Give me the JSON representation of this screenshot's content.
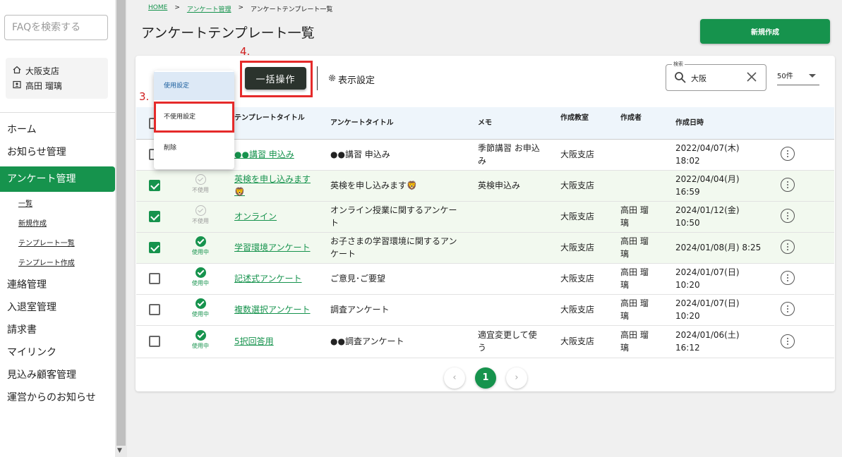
{
  "sidebar": {
    "faq_placeholder": "FAQを検索する",
    "branch": "大阪支店",
    "user": "高田 瑠璃",
    "menu": [
      "ホーム",
      "お知らせ管理",
      "アンケート管理"
    ],
    "submenu": [
      "一覧",
      "新規作成",
      "テンプレート一覧",
      "テンプレート作成"
    ],
    "menu2": [
      "連絡管理",
      "入退室管理",
      "請求書",
      "マイリンク",
      "見込み顧客管理",
      "運営からのお知らせ"
    ]
  },
  "breadcrumb": {
    "home": "HOME",
    "survey": "アンケート管理",
    "current": "アンケートテンプレート一覧",
    "sep": ">"
  },
  "page_title": "アンケートテンプレート一覧",
  "new_button": "新規作成",
  "toolbar": {
    "bulk_label": "一括操作",
    "display_settings": "表示設定",
    "search_label": "検索",
    "search_value": "大阪",
    "per_page": "50件"
  },
  "annotations": {
    "step3": "3.",
    "step4": "4."
  },
  "dropdown": [
    "使用設定",
    "不使用設定",
    "削除"
  ],
  "table": {
    "headers": {
      "template_title": "テンプレートタイトル",
      "survey_title": "アンケートタイトル",
      "memo": "メモ",
      "classroom": "作成教室",
      "creator": "作成者",
      "created_at": "作成日時"
    },
    "rows": [
      {
        "status": "",
        "title": "●●講習 申込み",
        "survey": "●●講習 申込み",
        "memo": "季節講習 お申込み",
        "classroom": "大阪支店",
        "creator": "",
        "date": "2022/04/07(木) 18:02"
      },
      {
        "status": "不使用",
        "title": "英検を申し込みます🦁",
        "survey": "英検を申し込みます🦁",
        "memo": "英検申込み",
        "classroom": "大阪支店",
        "creator": "",
        "date": "2022/04/04(月) 16:59"
      },
      {
        "status": "不使用",
        "title": "オンライン",
        "survey": "オンライン授業に関するアンケート",
        "memo": "",
        "classroom": "大阪支店",
        "creator": "高田 瑠璃",
        "date": "2024/01/12(金) 10:50"
      },
      {
        "status": "使用中",
        "title": "学習環境アンケート",
        "survey": "お子さまの学習環境に関するアンケート",
        "memo": "",
        "classroom": "大阪支店",
        "creator": "高田 瑠璃",
        "date": "2024/01/08(月) 8:25"
      },
      {
        "status": "使用中",
        "title": "記述式アンケート",
        "survey": "ご意見･ご要望",
        "memo": "",
        "classroom": "大阪支店",
        "creator": "高田 瑠璃",
        "date": "2024/01/07(日) 10:20"
      },
      {
        "status": "使用中",
        "title": "複数選択アンケート",
        "survey": "調査アンケート",
        "memo": "",
        "classroom": "大阪支店",
        "creator": "高田 瑠璃",
        "date": "2024/01/07(日) 10:20"
      },
      {
        "status": "使用中",
        "title": "5択回答用",
        "survey": "●●調査アンケート",
        "memo": "適宜変更して使う",
        "classroom": "大阪支店",
        "creator": "高田 瑠璃",
        "date": "2024/01/06(土) 16:12"
      }
    ]
  },
  "pagination": {
    "current": "1",
    "prev": "‹",
    "next": "›"
  },
  "colors": {
    "accent": "#16934d",
    "annotation_red": "#e52a2a"
  }
}
